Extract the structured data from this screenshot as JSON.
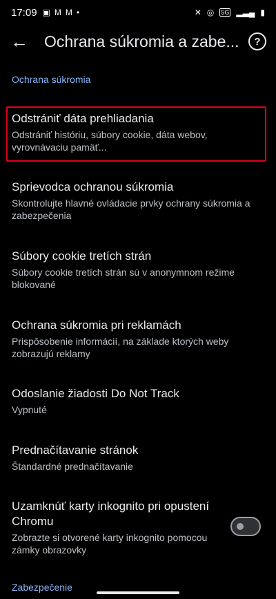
{
  "status_bar": {
    "time": "17:09",
    "left_icons": [
      "gallery-icon",
      "gmail-icon",
      "gmail-icon"
    ],
    "dot": "•",
    "network_badge": "5G"
  },
  "app_bar": {
    "title": "Ochrana súkromia a zabe..."
  },
  "sections": [
    {
      "header": "Ochrana súkromia",
      "items": [
        {
          "title": "Odstrániť dáta prehliadania",
          "subtitle": "Odstrániť históriu, súbory cookie, dáta webov, vyrovnávaciu pamäť..."
        },
        {
          "title": "Sprievodca ochranou súkromia",
          "subtitle": "Skontrolujte hlavné ovládacie prvky ochrany súkromia a zabezpečenia"
        },
        {
          "title": "Súbory cookie tretích strán",
          "subtitle": "Súbory cookie tretích strán sú v anonymnom režime blokované"
        },
        {
          "title": "Ochrana súkromia pri reklamách",
          "subtitle": "Prispôsobenie informácií, na základe ktorých weby zobrazujú reklamy"
        },
        {
          "title": "Odoslanie žiadosti Do Not Track",
          "subtitle": "Vypnuté"
        },
        {
          "title": "Prednačítavanie stránok",
          "subtitle": "Štandardné prednačítavanie"
        },
        {
          "title": "Uzamknúť karty inkognito pri opustení Chromu",
          "subtitle": "Zobrazte si otvorené karty inkognito pomocou zámky obrazovky",
          "toggle_on": false
        }
      ]
    },
    {
      "header": "Zabezpečenie"
    }
  ],
  "colors": {
    "background": "#000000",
    "accent": "#8ab4f8",
    "highlight": "#e0001a"
  }
}
